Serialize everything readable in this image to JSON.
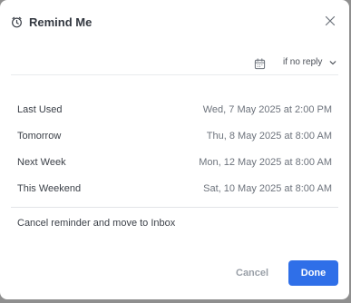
{
  "dialog": {
    "title": "Remind Me",
    "icon": "clock-icon",
    "close_icon": "close-icon"
  },
  "date_picker": {
    "calendar_icon": "calendar-icon",
    "reply_condition": "if no reply"
  },
  "options": [
    {
      "label": "Last Used",
      "value": "Wed, 7 May 2025 at 2:00 PM"
    },
    {
      "label": "Tomorrow",
      "value": "Thu, 8 May 2025 at 8:00 AM"
    },
    {
      "label": "Next Week",
      "value": "Mon, 12 May 2025 at 8:00 AM"
    },
    {
      "label": "This Weekend",
      "value": "Sat, 10 May 2025 at 8:00 AM"
    }
  ],
  "cancel_reminder_label": "Cancel reminder and move to Inbox",
  "footer": {
    "cancel_label": "Cancel",
    "done_label": "Done"
  },
  "colors": {
    "accent": "#2f6fe8",
    "backdrop": "#8f8f8f"
  }
}
